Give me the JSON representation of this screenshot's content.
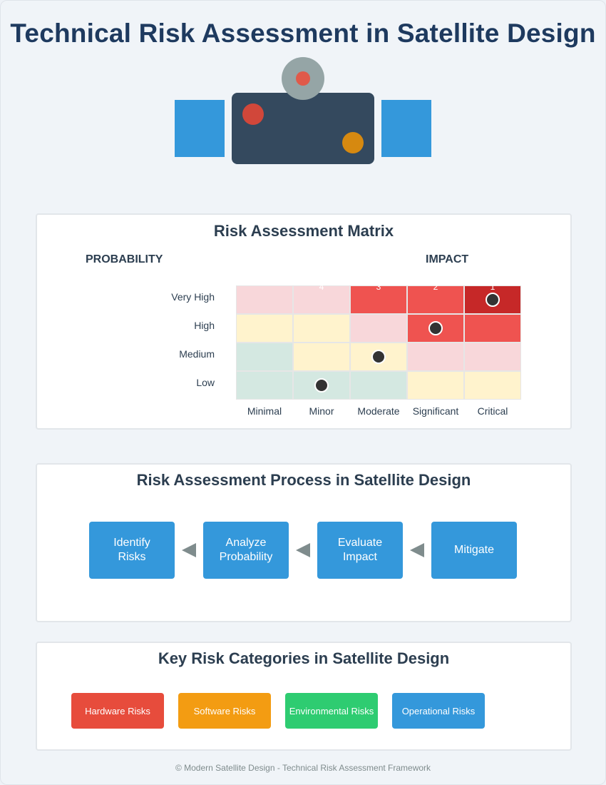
{
  "title": "Technical Risk Assessment in Satellite Design",
  "matrix": {
    "title": "Risk Assessment Matrix",
    "probability_label": "PROBABILITY",
    "impact_label": "IMPACT",
    "rows": [
      "Very High",
      "High",
      "Medium",
      "Low"
    ],
    "columns": [
      "Minimal",
      "Minor",
      "Moderate",
      "Significant",
      "Critical"
    ],
    "top_numbers": [
      "4",
      "3",
      "2",
      "1"
    ],
    "colors": {
      "pink": "#f8d7da",
      "cream": "#fff3cd",
      "green": "#d4e8e1",
      "red": "#ef5350",
      "dark_red": "#c62828"
    },
    "cells": [
      [
        "pink",
        "pink",
        "red",
        "red",
        "dark_red"
      ],
      [
        "cream",
        "cream",
        "pink",
        "red",
        "red"
      ],
      [
        "green",
        "cream",
        "cream",
        "pink",
        "pink"
      ],
      [
        "green",
        "green",
        "green",
        "cream",
        "cream"
      ]
    ],
    "markers": [
      {
        "row": "Very High",
        "column": "Critical"
      },
      {
        "row": "High",
        "column": "Significant"
      },
      {
        "row": "Medium",
        "column": "Moderate"
      },
      {
        "row": "Low",
        "column": "Minor"
      }
    ]
  },
  "process": {
    "title": "Risk Assessment Process in Satellite Design",
    "steps": [
      "Identify\nRisks",
      "Analyze\nProbability",
      "Evaluate\nImpact",
      "Mitigate"
    ],
    "arrow_color": "#7f8c8d",
    "step_color": "#3498db"
  },
  "categories": {
    "title": "Key Risk Categories in Satellite Design",
    "items": [
      {
        "label": "Hardware Risks",
        "color": "#e74c3c"
      },
      {
        "label": "Software Risks",
        "color": "#f39c12"
      },
      {
        "label": "Environmental Risks",
        "color": "#2ecc71"
      },
      {
        "label": "Operational Risks",
        "color": "#3498db"
      }
    ]
  },
  "footer": "© Modern Satellite Design - Technical Risk Assessment Framework"
}
